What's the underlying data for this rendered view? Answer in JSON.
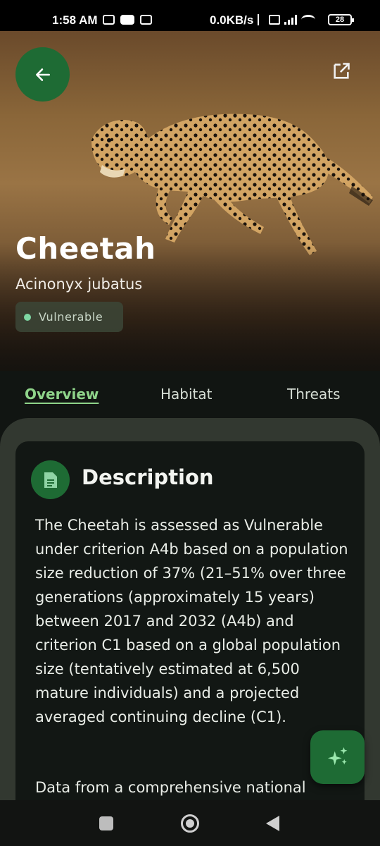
{
  "status_bar": {
    "time": "1:58 AM",
    "speed": "0.0KB/s",
    "battery": "28"
  },
  "hero": {
    "name": "Cheetah",
    "scientific_name": "Acinonyx jubatus",
    "status": "Vulnerable",
    "status_color": "#7ed8a4",
    "back_icon": "arrow-left-icon",
    "share_icon": "open-external-icon"
  },
  "tabs": [
    {
      "label": "Overview",
      "active": true
    },
    {
      "label": "Habitat",
      "active": false
    },
    {
      "label": "Threats",
      "active": false
    }
  ],
  "card": {
    "icon": "document-icon",
    "title": "Description",
    "paragraph1": "The Cheetah is assessed as Vulnerable under criterion A4b based on a population size reduction of 37% (21–51% over three generations (approximately 15 years) between 2017 and 2032 (A4b) and criterion C1 based on a global population size (tentatively estimated at 6,500 mature individuals) and a projected averaged continuing decline (C1).",
    "paragraph2": "Data from a comprehensive national"
  },
  "fab_icon": "sparkles-icon",
  "colors": {
    "accent": "#1e6b34",
    "tab_active": "#8fd48a",
    "background": "#111512",
    "sheet": "#323830"
  }
}
